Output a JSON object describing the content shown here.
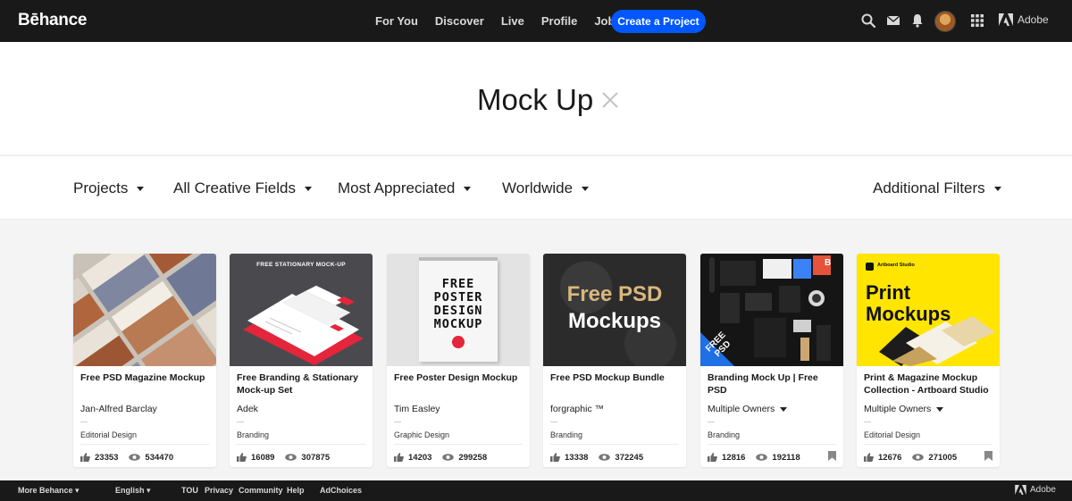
{
  "topbar": {
    "logo": "Bēhance",
    "nav": [
      "For You",
      "Discover",
      "Live",
      "Profile",
      "Jobs"
    ],
    "create_label": "Create a Project",
    "icons": [
      "search-icon",
      "mail-icon",
      "bell-icon",
      "avatar",
      "apps-grid-icon",
      "adobe-logo-icon"
    ],
    "adobe_label": "Adobe"
  },
  "search": {
    "term": "Mock Up"
  },
  "filters": {
    "projects": "Projects",
    "fields": "All Creative Fields",
    "sort": "Most Appreciated",
    "location": "Worldwide",
    "additional": "Additional Filters"
  },
  "cards": [
    {
      "title": "Free PSD Magazine Mockup",
      "owner": "Jan-Alfred Barclay",
      "field": "Editorial Design",
      "appreciations": "23353",
      "views": "534470"
    },
    {
      "title": "Free Branding & Stationary Mock-up Set",
      "owner": "Adek",
      "field": "Branding",
      "appreciations": "16089",
      "views": "307875",
      "thumb_text": "FREE STATIONARY MOCK-UP"
    },
    {
      "title": "Free Poster Design Mockup",
      "owner": "Tim Easley",
      "field": "Graphic Design",
      "appreciations": "14203",
      "views": "299258",
      "thumb_text": [
        "FREE",
        "POSTER",
        "DESIGN",
        "MOCKUP"
      ]
    },
    {
      "title": "Free PSD Mockup Bundle",
      "owner": "forgraphic ™",
      "field": "Branding",
      "appreciations": "13338",
      "views": "372245",
      "thumb_text": [
        "Free PSD",
        "Mockups"
      ]
    },
    {
      "title": "Branding Mock Up | Free PSD",
      "owner": "Multiple Owners",
      "field": "Branding",
      "appreciations": "12816",
      "views": "192118",
      "thumb_text": [
        "FREE",
        "PSD",
        "B"
      ]
    },
    {
      "title": "Print & Magazine Mockup Collection - Artboard Studio",
      "owner": "Multiple Owners",
      "field": "Editorial Design",
      "appreciations": "12676",
      "views": "271005",
      "thumb_text": [
        "Artboard Studio",
        "Print",
        "Mockups"
      ]
    }
  ],
  "footer": {
    "more": "More Behance",
    "language": "English",
    "links": [
      "TOU",
      "Privacy",
      "Community",
      "Help",
      "AdChoices"
    ],
    "adobe": "Adobe"
  },
  "colors": {
    "topbar": "#191919",
    "accent_blue": "#0057ff",
    "card_yellow": "#ffe500",
    "card_red": "#e4253b"
  }
}
